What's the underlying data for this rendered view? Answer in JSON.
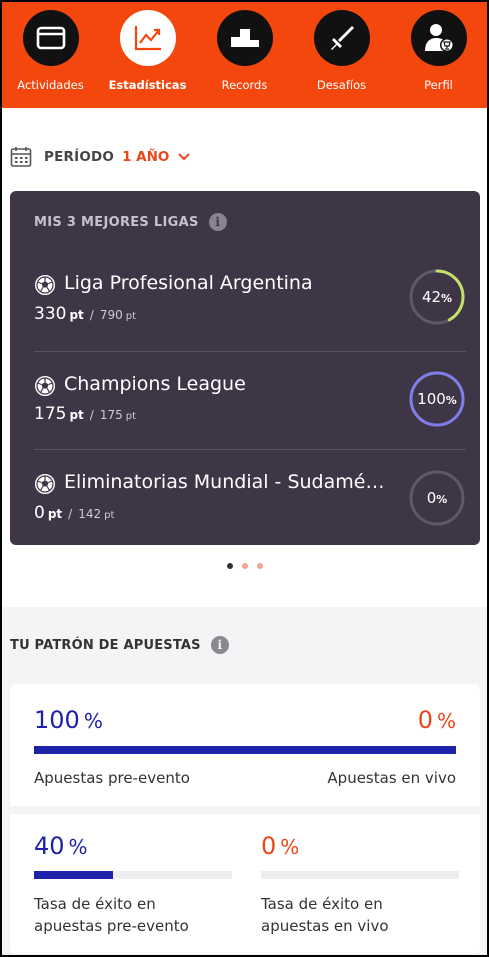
{
  "nav": {
    "items": [
      {
        "label": "Actividades",
        "icon": "activities-icon"
      },
      {
        "label": "Estadísticas",
        "icon": "chart-icon",
        "active": true
      },
      {
        "label": "Records",
        "icon": "podium-icon"
      },
      {
        "label": "Desafíos",
        "icon": "sword-icon"
      },
      {
        "label": "Perfil",
        "icon": "profile-icon"
      }
    ],
    "accent": "#f4470e"
  },
  "period": {
    "label": "PERÍODO",
    "value": "1 AÑO"
  },
  "leagues": {
    "title": "MIS 3 MEJORES LIGAS",
    "items": [
      {
        "name": "Liga Profesional Argentina",
        "points": "330",
        "unit": "pt",
        "total": "790",
        "total_unit": "pt",
        "percent": "42",
        "percent_sym": "%",
        "fraction": 0.42,
        "ring_color": "#c5e06a"
      },
      {
        "name": "Champions League",
        "points": "175",
        "unit": "pt",
        "total": "175",
        "total_unit": "pt",
        "percent": "100",
        "percent_sym": "%",
        "fraction": 1.0,
        "ring_color": "#7f7de8"
      },
      {
        "name": "Eliminatorias Mundial - Sudamé…",
        "points": "0",
        "unit": "pt",
        "total": "142",
        "total_unit": "pt",
        "percent": "0",
        "percent_sym": "%",
        "fraction": 0.0,
        "ring_color": "#7f7de8"
      }
    ]
  },
  "carousel": {
    "count": 3,
    "active": 0
  },
  "pattern": {
    "title": "TU PATRÓN DE APUESTAS",
    "pre_event": {
      "value": "100",
      "sym": "%",
      "label": "Apuestas pre-evento",
      "fraction": 1.0
    },
    "live": {
      "value": "0",
      "sym": "%",
      "label": "Apuestas en vivo"
    },
    "pre_success": {
      "value": "40",
      "sym": "%",
      "label_line1": "Tasa de éxito en",
      "label_line2": "apuestas pre-evento",
      "fraction": 0.4
    },
    "live_success": {
      "value": "0",
      "sym": "%",
      "label_line1": "Tasa de éxito en",
      "label_line2": "apuestas en vivo",
      "fraction": 0.0
    }
  }
}
